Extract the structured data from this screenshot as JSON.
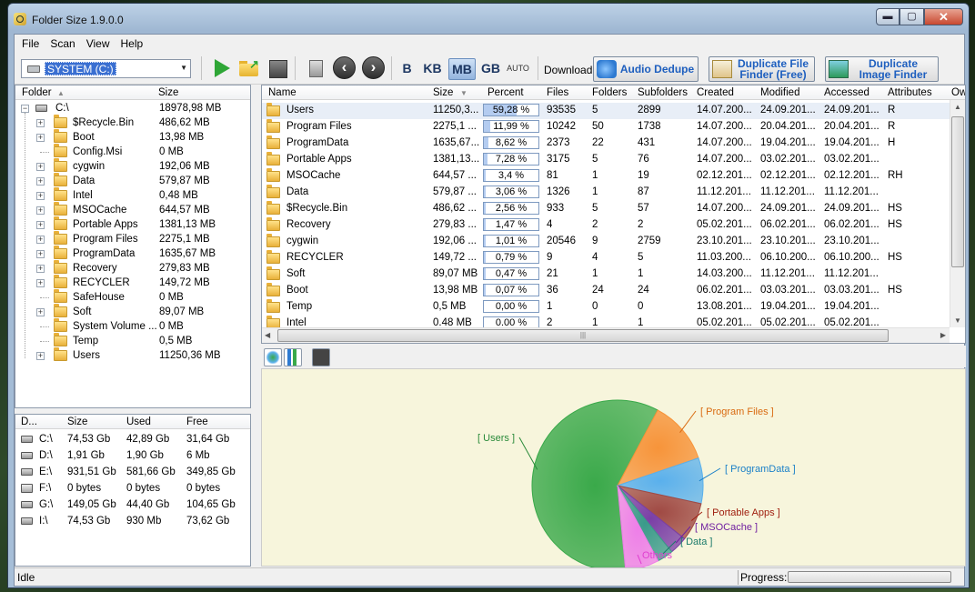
{
  "window": {
    "title": "Folder Size 1.9.0.0",
    "buttons": {
      "minimize": "▬",
      "maximize": "▢",
      "close": "✕"
    }
  },
  "menu": [
    "File",
    "Scan",
    "View",
    "Help"
  ],
  "toolbar": {
    "drive": "SYSTEM (C:)",
    "units": [
      "B",
      "KB",
      "MB",
      "GB",
      "AUTO"
    ],
    "active_unit": "MB",
    "download_label": "Download:",
    "ads": [
      {
        "label": "Audio Dedupe",
        "icon": "audio-dedupe-icon"
      },
      {
        "label": "Duplicate File Finder (Free)",
        "icon": "duplicate-file-icon"
      },
      {
        "label": "Duplicate Image Finder",
        "icon": "duplicate-image-icon"
      }
    ]
  },
  "tree": {
    "headers": {
      "folder": "Folder",
      "size": "Size"
    },
    "root": {
      "name": "C:\\",
      "size": "18978,98 MB"
    },
    "items": [
      {
        "name": "$Recycle.Bin",
        "size": "486,62 MB",
        "expandable": true
      },
      {
        "name": "Boot",
        "size": "13,98 MB",
        "expandable": true
      },
      {
        "name": "Config.Msi",
        "size": "0 MB",
        "expandable": false
      },
      {
        "name": "cygwin",
        "size": "192,06 MB",
        "expandable": true
      },
      {
        "name": "Data",
        "size": "579,87 MB",
        "expandable": true
      },
      {
        "name": "Intel",
        "size": "0,48 MB",
        "expandable": true
      },
      {
        "name": "MSOCache",
        "size": "644,57 MB",
        "expandable": true
      },
      {
        "name": "Portable Apps",
        "size": "1381,13 MB",
        "expandable": true
      },
      {
        "name": "Program Files",
        "size": "2275,1 MB",
        "expandable": true
      },
      {
        "name": "ProgramData",
        "size": "1635,67 MB",
        "expandable": true
      },
      {
        "name": "Recovery",
        "size": "279,83 MB",
        "expandable": true
      },
      {
        "name": "RECYCLER",
        "size": "149,72 MB",
        "expandable": true
      },
      {
        "name": "SafeHouse",
        "size": "0 MB",
        "expandable": false
      },
      {
        "name": "Soft",
        "size": "89,07 MB",
        "expandable": true
      },
      {
        "name": "System Volume ...",
        "size": "0 MB",
        "expandable": false
      },
      {
        "name": "Temp",
        "size": "0,5 MB",
        "expandable": false
      },
      {
        "name": "Users",
        "size": "11250,36 MB",
        "expandable": true
      }
    ]
  },
  "drives": {
    "headers": {
      "drive": "D...",
      "size": "Size",
      "used": "Used",
      "free": "Free"
    },
    "rows": [
      {
        "drive": "C:\\",
        "size": "74,53 Gb",
        "used": "42,89 Gb",
        "free": "31,64 Gb",
        "icon": "hard-drive-icon"
      },
      {
        "drive": "D:\\",
        "size": "1,91 Gb",
        "used": "1,90 Gb",
        "free": "6 Mb",
        "icon": "hard-drive-icon"
      },
      {
        "drive": "E:\\",
        "size": "931,51 Gb",
        "used": "581,66 Gb",
        "free": "349,85 Gb",
        "icon": "hard-drive-icon"
      },
      {
        "drive": "F:\\",
        "size": "0 bytes",
        "used": "0 bytes",
        "free": "0 bytes",
        "icon": "usb-drive-icon"
      },
      {
        "drive": "G:\\",
        "size": "149,05 Gb",
        "used": "44,40 Gb",
        "free": "104,65 Gb",
        "icon": "hard-drive-icon"
      },
      {
        "drive": "I:\\",
        "size": "74,53 Gb",
        "used": "930 Mb",
        "free": "73,62 Gb",
        "icon": "hard-drive-icon"
      }
    ]
  },
  "list": {
    "headers": {
      "name": "Name",
      "size": "Size",
      "percent": "Percent",
      "files": "Files",
      "folders": "Folders",
      "subfolders": "Subfolders",
      "created": "Created",
      "modified": "Modified",
      "accessed": "Accessed",
      "attributes": "Attributes",
      "owner": "Owr"
    },
    "rows": [
      {
        "name": "Users",
        "size": "11250,3...",
        "percent": "59,28 %",
        "pct": 59.28,
        "files": "93535",
        "folders": "5",
        "subfolders": "2899",
        "created": "14.07.200...",
        "modified": "24.09.201...",
        "accessed": "24.09.201...",
        "attributes": "R"
      },
      {
        "name": "Program Files",
        "size": "2275,1 ...",
        "percent": "11,99 %",
        "pct": 11.99,
        "files": "10242",
        "folders": "50",
        "subfolders": "1738",
        "created": "14.07.200...",
        "modified": "20.04.201...",
        "accessed": "20.04.201...",
        "attributes": "R"
      },
      {
        "name": "ProgramData",
        "size": "1635,67...",
        "percent": "8,62 %",
        "pct": 8.62,
        "files": "2373",
        "folders": "22",
        "subfolders": "431",
        "created": "14.07.200...",
        "modified": "19.04.201...",
        "accessed": "19.04.201...",
        "attributes": "H"
      },
      {
        "name": "Portable Apps",
        "size": "1381,13...",
        "percent": "7,28 %",
        "pct": 7.28,
        "files": "3175",
        "folders": "5",
        "subfolders": "76",
        "created": "14.07.200...",
        "modified": "03.02.201...",
        "accessed": "03.02.201...",
        "attributes": ""
      },
      {
        "name": "MSOCache",
        "size": "644,57 ...",
        "percent": "3,4 %",
        "pct": 3.4,
        "files": "81",
        "folders": "1",
        "subfolders": "19",
        "created": "02.12.201...",
        "modified": "02.12.201...",
        "accessed": "02.12.201...",
        "attributes": "RH"
      },
      {
        "name": "Data",
        "size": "579,87 ...",
        "percent": "3,06 %",
        "pct": 3.06,
        "files": "1326",
        "folders": "1",
        "subfolders": "87",
        "created": "11.12.201...",
        "modified": "11.12.201...",
        "accessed": "11.12.201...",
        "attributes": ""
      },
      {
        "name": "$Recycle.Bin",
        "size": "486,62 ...",
        "percent": "2,56 %",
        "pct": 2.56,
        "files": "933",
        "folders": "5",
        "subfolders": "57",
        "created": "14.07.200...",
        "modified": "24.09.201...",
        "accessed": "24.09.201...",
        "attributes": "HS"
      },
      {
        "name": "Recovery",
        "size": "279,83 ...",
        "percent": "1,47 %",
        "pct": 1.47,
        "files": "4",
        "folders": "2",
        "subfolders": "2",
        "created": "05.02.201...",
        "modified": "06.02.201...",
        "accessed": "06.02.201...",
        "attributes": "HS"
      },
      {
        "name": "cygwin",
        "size": "192,06 ...",
        "percent": "1,01 %",
        "pct": 1.01,
        "files": "20546",
        "folders": "9",
        "subfolders": "2759",
        "created": "23.10.201...",
        "modified": "23.10.201...",
        "accessed": "23.10.201...",
        "attributes": ""
      },
      {
        "name": "RECYCLER",
        "size": "149,72 ...",
        "percent": "0,79 %",
        "pct": 0.79,
        "files": "9",
        "folders": "4",
        "subfolders": "5",
        "created": "11.03.200...",
        "modified": "06.10.200...",
        "accessed": "06.10.200...",
        "attributes": "HS"
      },
      {
        "name": "Soft",
        "size": "89,07 MB",
        "percent": "0,47 %",
        "pct": 0.47,
        "files": "21",
        "folders": "1",
        "subfolders": "1",
        "created": "14.03.200...",
        "modified": "11.12.201...",
        "accessed": "11.12.201...",
        "attributes": ""
      },
      {
        "name": "Boot",
        "size": "13,98 MB",
        "percent": "0,07 %",
        "pct": 0.07,
        "files": "36",
        "folders": "24",
        "subfolders": "24",
        "created": "06.02.201...",
        "modified": "03.03.201...",
        "accessed": "03.03.201...",
        "attributes": "HS"
      },
      {
        "name": "Temp",
        "size": "0,5 MB",
        "percent": "0,00 %",
        "pct": 0.0,
        "files": "1",
        "folders": "0",
        "subfolders": "0",
        "created": "13.08.201...",
        "modified": "19.04.201...",
        "accessed": "19.04.201...",
        "attributes": ""
      },
      {
        "name": "Intel",
        "size": "0.48 MB",
        "percent": "0.00 %",
        "pct": 0.0,
        "files": "2",
        "folders": "1",
        "subfolders": "1",
        "created": "05.02.201...",
        "modified": "05.02.201...",
        "accessed": "05.02.201...",
        "attributes": ""
      }
    ]
  },
  "chart_tabs": [
    "pie-chart-tab-icon",
    "bar-chart-tab-icon",
    "export-tab-icon"
  ],
  "chart_data": {
    "type": "pie",
    "slices": [
      {
        "label": "[ Users ]",
        "value": 59.28,
        "color": "#3aa94a",
        "label_color": "#2a8a3a"
      },
      {
        "label": "[ Program Files ]",
        "value": 11.99,
        "color": "#f7943a",
        "label_color": "#d96a10"
      },
      {
        "label": "[ ProgramData ]",
        "value": 8.62,
        "color": "#5ab0ec",
        "label_color": "#1b80c8"
      },
      {
        "label": "[ Portable Apps ]",
        "value": 7.28,
        "color": "#a04a44",
        "label_color": "#a02010"
      },
      {
        "label": "[ MSOCache ]",
        "value": 3.4,
        "color": "#7a3fa6",
        "label_color": "#7020a0"
      },
      {
        "label": "[ Data ]",
        "value": 3.06,
        "color": "#3a9a8a",
        "label_color": "#1a7a6a"
      },
      {
        "label": "Others",
        "value": 6.37,
        "color": "#ee7ee8",
        "label_color": "#e040d0"
      }
    ]
  },
  "status": {
    "left": "Idle",
    "progress_label": "Progress:",
    "progress": 0
  }
}
